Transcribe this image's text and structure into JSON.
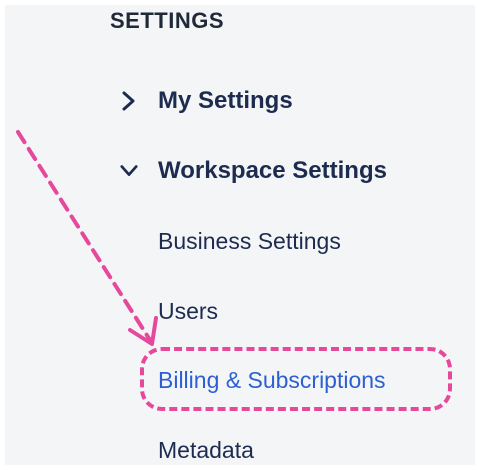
{
  "settings": {
    "section_title": "SETTINGS",
    "groups": [
      {
        "label": "My Settings",
        "expanded": false,
        "icon": "chevron-right-icon"
      },
      {
        "label": "Workspace Settings",
        "expanded": true,
        "icon": "chevron-down-icon"
      }
    ],
    "items": [
      {
        "label": "Business Settings"
      },
      {
        "label": "Users"
      },
      {
        "label": "Billing & Subscriptions",
        "active": true
      },
      {
        "label": "Metadata"
      }
    ]
  },
  "colors": {
    "text": "#1d2b4f",
    "active_link": "#2d5fd3",
    "annotation": "#e6489b",
    "panel_bg": "#f4f5f7"
  }
}
